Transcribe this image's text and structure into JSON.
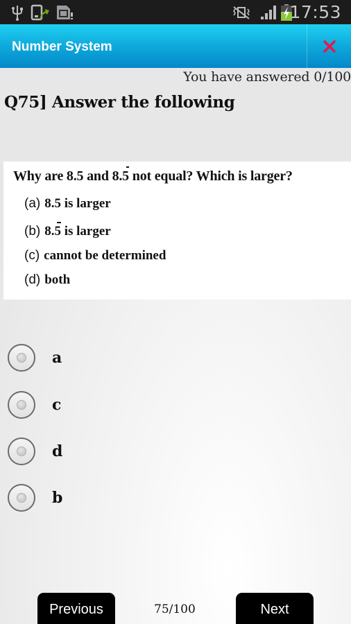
{
  "status_bar": {
    "time": "17:53",
    "left_icons": [
      "usb-icon",
      "screen-transfer-icon",
      "sd-card-icon"
    ],
    "right_icons": [
      "vibrate-mute-icon",
      "signal-icon",
      "battery-charging-icon"
    ]
  },
  "app_bar": {
    "title": "Number System",
    "close_icon": "close-icon",
    "accent_color": "#0ea9dc",
    "close_color": "#e8174a"
  },
  "progress": {
    "answered_text": "You have answered 0/100"
  },
  "question": {
    "title": "Q75]  Answer the following",
    "image": {
      "prompt_parts": [
        "Why are 8.5 and ",
        "8.5",
        " not equal? Which is larger?"
      ],
      "options": [
        {
          "label": "(a)",
          "pre": "8.5",
          "repeating": false,
          "text": " is larger"
        },
        {
          "label": "(b)",
          "pre": "8.5",
          "repeating": true,
          "text": " is larger"
        },
        {
          "label": "(c)",
          "pre": "",
          "repeating": false,
          "text": "cannot be determined"
        },
        {
          "label": "(d)",
          "pre": "",
          "repeating": false,
          "text": "both"
        }
      ]
    }
  },
  "answers": [
    {
      "label": "a",
      "selected": false
    },
    {
      "label": "c",
      "selected": false
    },
    {
      "label": "d",
      "selected": false
    },
    {
      "label": "b",
      "selected": false
    }
  ],
  "footer": {
    "previous_label": "Previous",
    "next_label": "Next",
    "page_indicator": "75/100"
  }
}
